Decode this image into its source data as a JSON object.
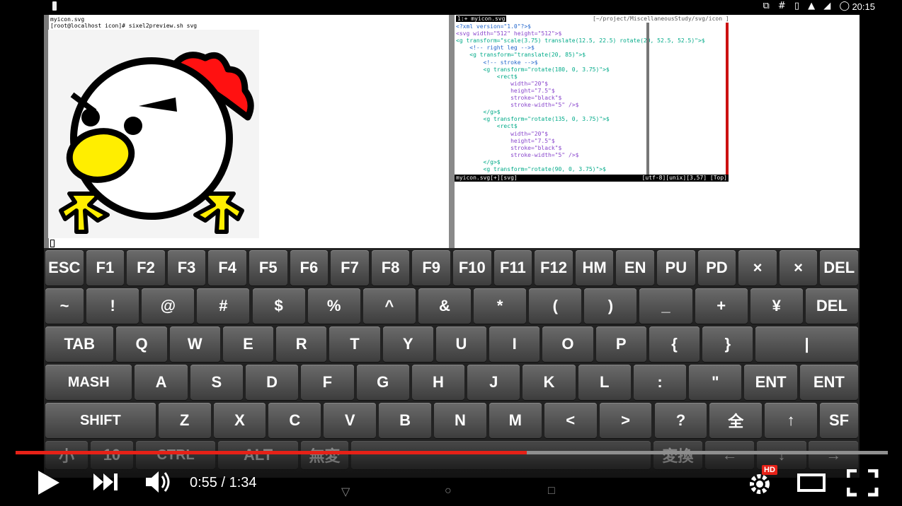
{
  "status_bar": {
    "icons": "⧉ # ▯ ▲ ◢ ◯",
    "clock": "20:15"
  },
  "left_terminal": {
    "line1": "myicon.svg",
    "line2": "[root@localhost icon]# sixel2preview.sh svg"
  },
  "vim": {
    "tab_active": "1:+ myicon.svg",
    "tab_path": "[~/project/MiscellaneousStudy/svg/icon ]",
    "lines": [
      {
        "text": "<?xml version=\"1.0\"?>$",
        "c": "blue"
      },
      {
        "text": "<svg width=\"512\" height=\"512\">$",
        "c": "purple"
      },
      {
        "text": "<g transform=\"scale(3.75) translate(12.5, 22.5) rotate(20, 52.5, 52.5)\">$",
        "c": "green"
      },
      {
        "text": "    <!-- right leg -->$",
        "c": "blue"
      },
      {
        "text": "    <g transform=\"translate(20, 85)\">$",
        "c": "green"
      },
      {
        "text": "        <!-- stroke -->$",
        "c": "blue"
      },
      {
        "text": "        <g transform=\"rotate(180, 0, 3.75)\">$",
        "c": "green"
      },
      {
        "text": "            <rect$",
        "c": "green"
      },
      {
        "text": "                width=\"20\"$",
        "c": "purple"
      },
      {
        "text": "                height=\"7.5\"$",
        "c": "purple"
      },
      {
        "text": "                stroke=\"black\"$",
        "c": "purple"
      },
      {
        "text": "                stroke-width=\"5\" />$",
        "c": "purple"
      },
      {
        "text": "        </g>$",
        "c": "green"
      },
      {
        "text": "        <g transform=\"rotate(135, 0, 3.75)\">$",
        "c": "green"
      },
      {
        "text": "            <rect$",
        "c": "green"
      },
      {
        "text": "                width=\"20\"$",
        "c": "purple"
      },
      {
        "text": "                height=\"7.5\"$",
        "c": "purple"
      },
      {
        "text": "                stroke=\"black\"$",
        "c": "purple"
      },
      {
        "text": "                stroke-width=\"5\" />$",
        "c": "purple"
      },
      {
        "text": "        </g>$",
        "c": "green"
      },
      {
        "text": "        <g transform=\"rotate(90, 0, 3.75)\">$",
        "c": "green"
      }
    ],
    "status_left": "myicon.svg[+][svg]",
    "status_right": "[utf-8][unix][3,57] [Top]"
  },
  "keyboard": {
    "rows": [
      [
        "ESC",
        "F1",
        "F2",
        "F3",
        "F4",
        "F5",
        "F6",
        "F7",
        "F8",
        "F9",
        "F10",
        "F11",
        "F12",
        "HM",
        "EN",
        "PU",
        "PD",
        "×",
        "×",
        "DEL"
      ],
      [
        "~",
        "!",
        "@",
        "#",
        "$",
        "%",
        "^",
        "&",
        "*",
        "(",
        ")",
        "_",
        "+",
        "¥",
        "DEL"
      ],
      [
        "TAB",
        "Q",
        "W",
        "E",
        "R",
        "T",
        "Y",
        "U",
        "I",
        "O",
        "P",
        "{",
        "}",
        "|"
      ],
      [
        "MASH",
        "A",
        "S",
        "D",
        "F",
        "G",
        "H",
        "J",
        "K",
        "L",
        ":",
        "\"",
        "ENT",
        "ENT"
      ],
      [
        "SHIFT",
        "Z",
        "X",
        "C",
        "V",
        "B",
        "N",
        "M",
        "<",
        ">",
        "?",
        "全",
        "↑",
        "SF"
      ],
      [
        "小",
        "10",
        "CTRL",
        "ALT",
        "無変",
        "",
        "変換",
        "←",
        "↓",
        "→"
      ]
    ]
  },
  "video": {
    "time": "0:55 / 1:34",
    "progress_fraction": 0.586,
    "hd_badge": "HD",
    "accent": "#e62117"
  },
  "icons": {
    "play": "play-icon",
    "next": "next-icon",
    "volume": "volume-icon",
    "settings": "settings-icon",
    "theater": "theater-icon",
    "fullscreen": "fullscreen-icon"
  }
}
